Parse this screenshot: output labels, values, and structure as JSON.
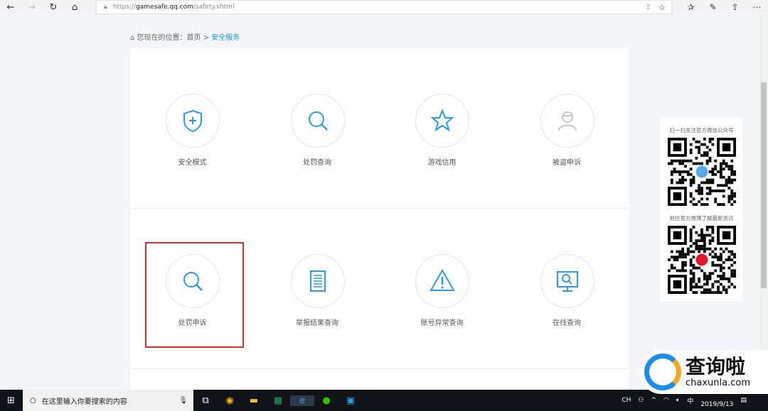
{
  "browser": {
    "url_prefix": "https://",
    "url_domain": "gamesafe.qq.com",
    "url_path": "/safety.shtml"
  },
  "breadcrumb": {
    "prefix": "您现在的位置：",
    "home": "首页",
    "sep": " > ",
    "current": "安全服务"
  },
  "services": [
    {
      "label": "安全模式",
      "icon": "shield-plus-icon"
    },
    {
      "label": "处罚查询",
      "icon": "search-icon"
    },
    {
      "label": "游戏信用",
      "icon": "star-icon"
    },
    {
      "label": "被盗申诉",
      "icon": "user-icon"
    },
    {
      "label": "处罚申诉",
      "icon": "search-icon"
    },
    {
      "label": "举报结果查询",
      "icon": "document-icon"
    },
    {
      "label": "账号异常查询",
      "icon": "warning-icon"
    },
    {
      "label": "在线查询",
      "icon": "monitor-search-icon"
    }
  ],
  "sidebar": {
    "wechat_caption": "扫一扫关注官方微信公众号",
    "weibo_caption": "前往官方微博了解最新资讯"
  },
  "taskbar": {
    "search_placeholder": "在这里输入你要搜索的内容",
    "ime": "中",
    "lang": "CH",
    "date": "2019/9/13"
  },
  "watermark": {
    "title": "查询啦",
    "domain": "chaxunla.com"
  },
  "colors": {
    "accent": "#1a8fe3",
    "highlight": "#d9302c"
  }
}
